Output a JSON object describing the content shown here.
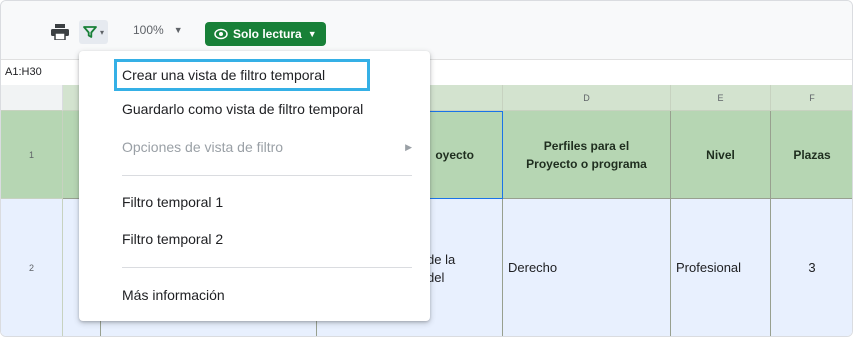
{
  "toolbar": {
    "zoom_value": "100%",
    "readonly_label": "Solo lectura"
  },
  "namebox": {
    "value": "A1:H30"
  },
  "columns": [
    {
      "id": "D",
      "label": "D"
    },
    {
      "id": "E",
      "label": "E"
    },
    {
      "id": "F",
      "label": "F"
    }
  ],
  "rows": [
    {
      "label": "1"
    },
    {
      "label": "2"
    }
  ],
  "table": {
    "header": {
      "c_partial": "oyecto",
      "d": "Perfiles para el Proyecto o programa",
      "e": "Nivel",
      "f": "Plazas"
    },
    "row2": {
      "c_partial_1": "de la",
      "c_partial_2": "del",
      "d": "Derecho",
      "e": "Profesional",
      "f": "3"
    }
  },
  "menu": {
    "items": [
      {
        "label": "Crear una vista de filtro temporal"
      },
      {
        "label": "Guardarlo como vista de filtro temporal"
      },
      {
        "label": "Opciones de vista de filtro"
      },
      {
        "label": "Filtro temporal 1"
      },
      {
        "label": "Filtro temporal 2"
      },
      {
        "label": "Más información"
      }
    ]
  },
  "icons": {
    "print": "printer-icon",
    "filter": "filter-icon",
    "readonly": "eye-icon"
  },
  "colors": {
    "readonly_green": "#188038",
    "highlight_blue": "#35b0e6",
    "header_green": "#b6d6b3",
    "data_blue": "#e8f0fe"
  }
}
